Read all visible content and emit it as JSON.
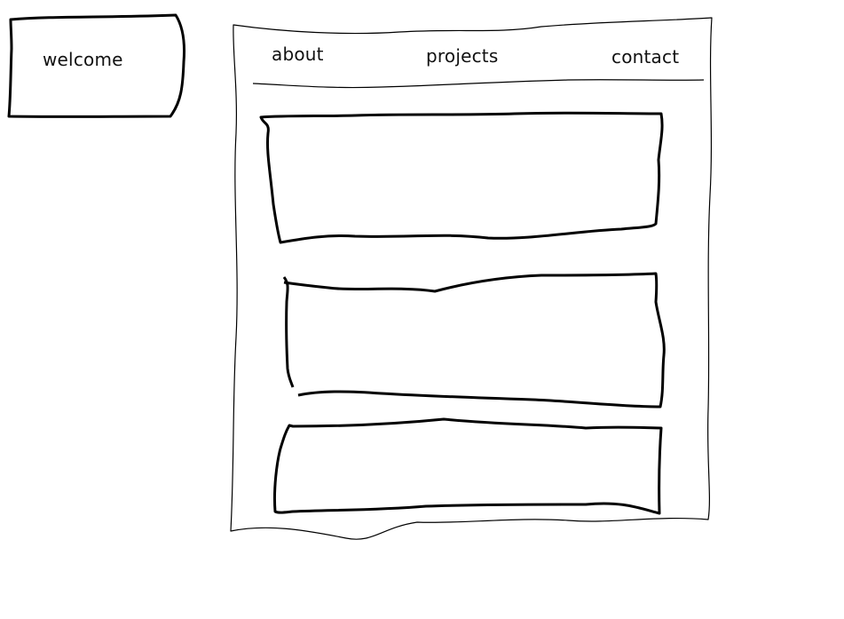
{
  "welcome": {
    "label": "welcome"
  },
  "nav": {
    "items": [
      {
        "label": "about"
      },
      {
        "label": "projects"
      },
      {
        "label": "contact"
      }
    ]
  },
  "content": {
    "boxes": [
      {
        "label": ""
      },
      {
        "label": ""
      },
      {
        "label": ""
      }
    ]
  },
  "colors": {
    "ink": "#000000",
    "background": "#ffffff"
  }
}
